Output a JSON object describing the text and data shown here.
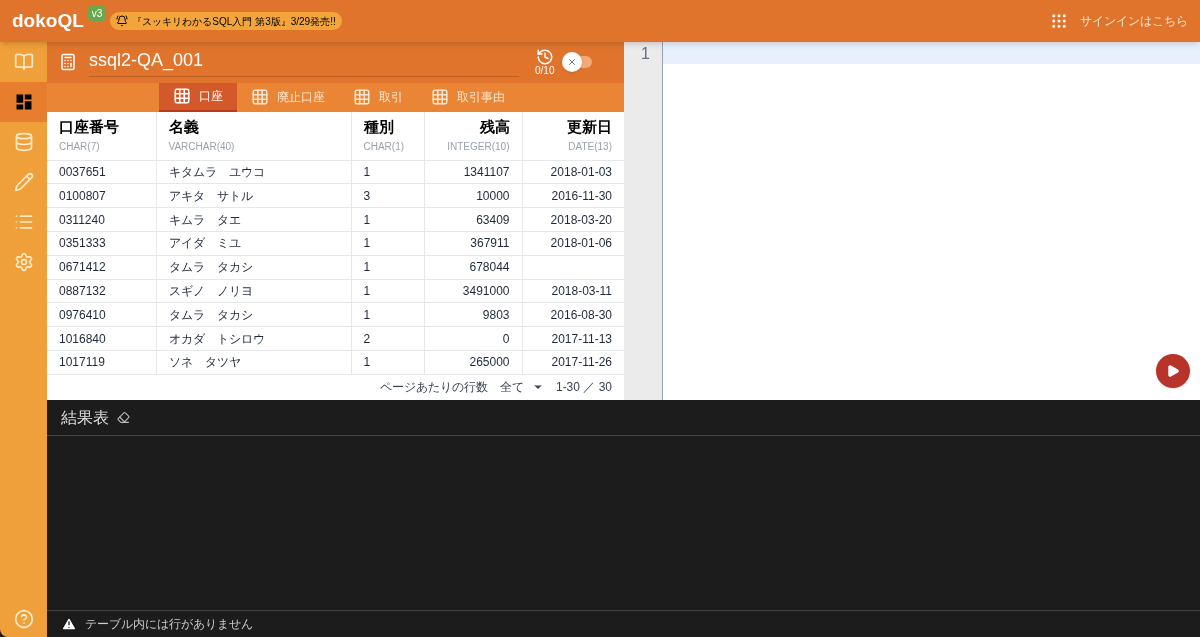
{
  "header": {
    "logo": "dokoQL",
    "version": "v3",
    "announcement": "『スッキリわかるSQL入門 第3版』3/29発売!!",
    "signin": "サインインはこちら"
  },
  "sidebar": {
    "items": [
      {
        "kind": "book",
        "selected": false
      },
      {
        "kind": "dashboard",
        "selected": true
      },
      {
        "kind": "database",
        "selected": false
      },
      {
        "kind": "pencil",
        "selected": false
      },
      {
        "kind": "list",
        "selected": false
      },
      {
        "kind": "settings",
        "selected": false
      }
    ],
    "help": {
      "kind": "help"
    }
  },
  "panel": {
    "title": "ssql2-QA_001",
    "history_count": "0/10",
    "toggle": {
      "on": false
    }
  },
  "tabs": [
    {
      "label": "口座",
      "selected": true
    },
    {
      "label": "廃止口座",
      "selected": false
    },
    {
      "label": "取引",
      "selected": false
    },
    {
      "label": "取引事由",
      "selected": false
    }
  ],
  "table": {
    "columns": [
      {
        "name": "口座番号",
        "type": "CHAR(7)",
        "kind": "text"
      },
      {
        "name": "名義",
        "type": "VARCHAR(40)",
        "kind": "text"
      },
      {
        "name": "種別",
        "type": "CHAR(1)",
        "kind": "text"
      },
      {
        "name": "残高",
        "type": "INTEGER(10)",
        "kind": "number"
      },
      {
        "name": "更新日",
        "type": "DATE(13)",
        "kind": "number"
      }
    ],
    "rows": [
      [
        "0037651",
        "キタムラ　ユウコ",
        "1",
        "1341107",
        "2018-01-03"
      ],
      [
        "0100807",
        "アキタ　サトル",
        "3",
        "10000",
        "2016-11-30"
      ],
      [
        "0311240",
        "キムラ　タエ",
        "1",
        "63409",
        "2018-03-20"
      ],
      [
        "0351333",
        "アイダ　ミユ",
        "1",
        "367911",
        "2018-01-06"
      ],
      [
        "0671412",
        "タムラ　タカシ",
        "1",
        "678044",
        ""
      ],
      [
        "0887132",
        "スギノ　ノリヨ",
        "1",
        "3491000",
        "2018-03-11"
      ],
      [
        "0976410",
        "タムラ　タカシ",
        "1",
        "9803",
        "2016-08-30"
      ],
      [
        "1016840",
        "オカダ　トシロウ",
        "2",
        "0",
        "2017-11-13"
      ],
      [
        "1017119",
        "ソネ　タツヤ",
        "1",
        "265000",
        "2017-11-26"
      ]
    ],
    "pagination": {
      "rows_per_page_label": "ページあたりの行数",
      "rows_per_page": "全て",
      "range": "1-30 ／ 30"
    }
  },
  "editor": {
    "line_numbers": [
      "1"
    ]
  },
  "results": {
    "title": "結果表",
    "status": "テーブル内には行がありません"
  }
}
